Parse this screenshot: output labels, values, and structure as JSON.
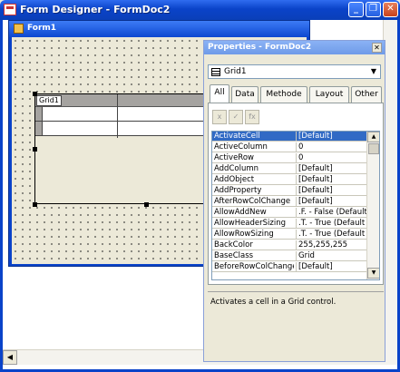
{
  "main_window": {
    "title": "Form Designer - FormDoc2",
    "buttons": {
      "minimize": "_",
      "restore": "❐",
      "close": "✕"
    }
  },
  "form_window": {
    "title": "Form1",
    "grid": {
      "caption": "Grid1"
    }
  },
  "properties": {
    "title": "Properties - FormDoc2",
    "close_label": "✕",
    "object_select": {
      "value": "Grid1"
    },
    "tabs": [
      "All",
      "Data",
      "Methode",
      "Layout",
      "Other"
    ],
    "active_tab": "All",
    "toolbar": {
      "cancel": "x",
      "accept": "✓",
      "fx": "fx"
    },
    "rows": [
      {
        "name": "ActivateCell",
        "value": "[Default]",
        "selected": true
      },
      {
        "name": "ActiveColumn",
        "value": "0"
      },
      {
        "name": "ActiveRow",
        "value": "0"
      },
      {
        "name": "AddColumn",
        "value": "[Default]"
      },
      {
        "name": "AddObject",
        "value": "[Default]"
      },
      {
        "name": "AddProperty",
        "value": "[Default]"
      },
      {
        "name": "AfterRowColChange",
        "value": "[Default]"
      },
      {
        "name": "AllowAddNew",
        "value": ".F. - False (Default"
      },
      {
        "name": "AllowHeaderSizing",
        "value": ".T. - True (Default"
      },
      {
        "name": "AllowRowSizing",
        "value": ".T. - True (Default"
      },
      {
        "name": "BackColor",
        "value": "255,255,255"
      },
      {
        "name": "BaseClass",
        "value": "Grid"
      },
      {
        "name": "BeforeRowColChange",
        "value": "[Default]"
      }
    ],
    "description": "Activates a cell in a Grid control."
  }
}
